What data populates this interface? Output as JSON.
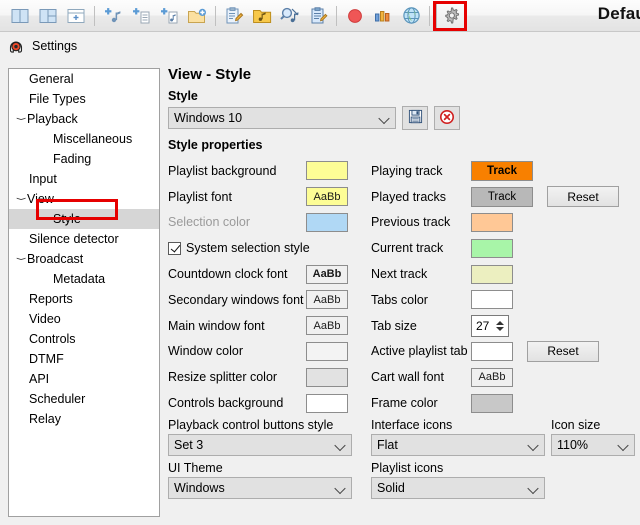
{
  "window": {
    "title": "Defau"
  },
  "toolbar": {
    "buttons": [
      {
        "name": "split-view-vertical-icon",
        "tip": "Split view vertical"
      },
      {
        "name": "split-view-mixed-icon",
        "tip": "Split view mixed"
      },
      {
        "name": "add-panel-icon",
        "tip": "Add panel"
      },
      {
        "name": "add-track-icon",
        "tip": "Add track"
      },
      {
        "name": "add-file-icon",
        "tip": "Add file"
      },
      {
        "name": "add-music-icon",
        "tip": "Add music"
      },
      {
        "name": "new-folder-icon",
        "tip": "New folder"
      },
      {
        "name": "edit-playlist-icon",
        "tip": "Edit playlist"
      },
      {
        "name": "music-folder-icon",
        "tip": "Music folder"
      },
      {
        "name": "search-music-icon",
        "tip": "Search music"
      },
      {
        "name": "clipboard-edit-icon",
        "tip": "Clipboard edit"
      },
      {
        "name": "record-icon",
        "tip": "Record"
      },
      {
        "name": "stats-icon",
        "tip": "Statistics"
      },
      {
        "name": "globe-icon",
        "tip": "Web"
      },
      {
        "name": "gear-icon",
        "tip": "Settings"
      }
    ],
    "highlight_color": "#e60000"
  },
  "settings_header": {
    "icon": "app-icon",
    "label": "Settings"
  },
  "tree": {
    "items": [
      {
        "label": "General",
        "indent": 1,
        "twisty": "",
        "selected": false
      },
      {
        "label": "File Types",
        "indent": 1,
        "twisty": "",
        "selected": false
      },
      {
        "label": "Playback",
        "indent": 0,
        "twisty": "v",
        "selected": false
      },
      {
        "label": "Miscellaneous",
        "indent": 2,
        "twisty": "",
        "selected": false
      },
      {
        "label": "Fading",
        "indent": 2,
        "twisty": "",
        "selected": false
      },
      {
        "label": "Input",
        "indent": 1,
        "twisty": "",
        "selected": false
      },
      {
        "label": "View",
        "indent": 0,
        "twisty": "v",
        "selected": false
      },
      {
        "label": "Style",
        "indent": 2,
        "twisty": "",
        "selected": true
      },
      {
        "label": "Silence detector",
        "indent": 1,
        "twisty": "",
        "selected": false
      },
      {
        "label": "Broadcast",
        "indent": 0,
        "twisty": "v",
        "selected": false
      },
      {
        "label": "Metadata",
        "indent": 2,
        "twisty": "",
        "selected": false
      },
      {
        "label": "Reports",
        "indent": 1,
        "twisty": "",
        "selected": false
      },
      {
        "label": "Video",
        "indent": 1,
        "twisty": "",
        "selected": false
      },
      {
        "label": "Controls",
        "indent": 1,
        "twisty": "",
        "selected": false
      },
      {
        "label": "DTMF",
        "indent": 1,
        "twisty": "",
        "selected": false
      },
      {
        "label": "API",
        "indent": 1,
        "twisty": "",
        "selected": false
      },
      {
        "label": "Scheduler",
        "indent": 1,
        "twisty": "",
        "selected": false
      },
      {
        "label": "Relay",
        "indent": 1,
        "twisty": "",
        "selected": false
      }
    ],
    "selection_bg": "#d6d6d6",
    "highlight_color": "#e60000"
  },
  "pane": {
    "title": "View - Style",
    "style_group_label": "Style",
    "style_value": "Windows 10",
    "save_icon": "save-disk-icon",
    "delete_icon": "delete-circle-icon",
    "properties_label": "Style properties",
    "left_rows": [
      {
        "label": "Playlist background",
        "type": "swatch",
        "color": "#fdfd96",
        "dim": false
      },
      {
        "label": "Playlist font",
        "type": "font",
        "color": "#fdfd96",
        "text": "AaBb",
        "dim": false
      },
      {
        "label": "Selection color",
        "type": "swatch",
        "color": "#b0d8f5",
        "dim": true
      },
      {
        "label": "System selection style",
        "type": "check",
        "checked": true,
        "dim": false
      },
      {
        "label": "Countdown clock font",
        "type": "font",
        "color": "#f0f0f0",
        "text": "AaBb",
        "bold": true,
        "dim": false
      },
      {
        "label": "Secondary windows font",
        "type": "font",
        "color": "#f0f0f0",
        "text": "AaBb",
        "dim": false
      },
      {
        "label": "Main window font",
        "type": "font",
        "color": "#f0f0f0",
        "text": "AaBb",
        "dim": false
      },
      {
        "label": "Window color",
        "type": "swatch",
        "color": "#f3f3f3",
        "dim": false
      },
      {
        "label": "Resize splitter color",
        "type": "swatch",
        "color": "#e2e2e2",
        "dim": false
      },
      {
        "label": "Controls background",
        "type": "swatch",
        "color": "#ffffff",
        "dim": false
      }
    ],
    "right_rows": [
      {
        "label": "Playing track",
        "type": "track",
        "color": "#f88000",
        "text": "Track",
        "bold": true
      },
      {
        "label": "Played tracks",
        "type": "track",
        "color": "#b8b8b8",
        "text": "Track",
        "button": "Reset"
      },
      {
        "label": "Previous track",
        "type": "swatch",
        "color": "#ffc896"
      },
      {
        "label": "Current track",
        "type": "swatch",
        "color": "#a8f5a8"
      },
      {
        "label": "Next track",
        "type": "swatch",
        "color": "#ecefc0"
      },
      {
        "label": "Tabs color",
        "type": "swatch",
        "color": "#ffffff"
      },
      {
        "label": "Tab size",
        "type": "spin",
        "value": "27"
      },
      {
        "label": "Active playlist tab",
        "type": "text",
        "value": "",
        "button": "Reset"
      },
      {
        "label": "Cart wall font",
        "type": "font",
        "color": "#f0f0f0",
        "text": "AaBb"
      },
      {
        "label": "Frame color",
        "type": "swatch",
        "color": "#c8c8c8"
      }
    ],
    "bottom": {
      "playback_buttons_label": "Playback control buttons style",
      "playback_buttons_value": "Set 3",
      "ui_theme_label": "UI Theme",
      "ui_theme_value": "Windows",
      "interface_icons_label": "Interface icons",
      "interface_icons_value": "Flat",
      "playlist_icons_label": "Playlist icons",
      "playlist_icons_value": "Solid",
      "icon_size_label": "Icon size",
      "icon_size_value": "110%"
    }
  }
}
